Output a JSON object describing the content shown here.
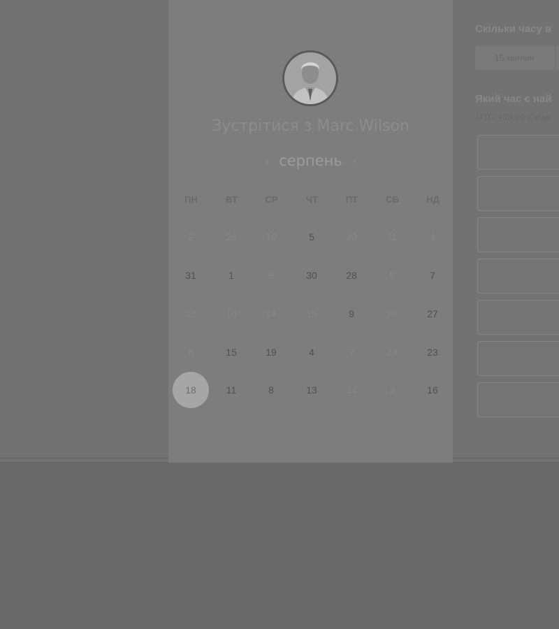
{
  "profile": {
    "meet_title": "Зустрітися з Marc Wilson"
  },
  "calendar": {
    "month": "серпень",
    "prev_icon": "chevron-left-icon",
    "next_icon": "chevron-right-icon",
    "weekdays": [
      "ПН",
      "ВТ",
      "СР",
      "ЧТ",
      "ПТ",
      "СБ",
      "НД"
    ],
    "rows": [
      [
        {
          "label": "2",
          "active": false
        },
        {
          "label": "29",
          "active": false
        },
        {
          "label": "19",
          "active": false
        },
        {
          "label": "5",
          "active": true
        },
        {
          "label": "20",
          "active": false
        },
        {
          "label": "11",
          "active": false
        },
        {
          "label": "4",
          "active": false
        }
      ],
      [
        {
          "label": "31",
          "active": true
        },
        {
          "label": "1",
          "active": true
        },
        {
          "label": "9",
          "active": false
        },
        {
          "label": "30",
          "active": true
        },
        {
          "label": "28",
          "active": true
        },
        {
          "label": "6",
          "active": false
        },
        {
          "label": "7",
          "active": true
        }
      ],
      [
        {
          "label": "12",
          "active": false
        },
        {
          "label": "10",
          "active": false
        },
        {
          "label": "24",
          "active": false
        },
        {
          "label": "15",
          "active": false
        },
        {
          "label": "9",
          "active": true
        },
        {
          "label": "26",
          "active": false
        },
        {
          "label": "27",
          "active": true
        }
      ],
      [
        {
          "label": "8",
          "active": false
        },
        {
          "label": "15",
          "active": true
        },
        {
          "label": "19",
          "active": true
        },
        {
          "label": "4",
          "active": true
        },
        {
          "label": "7",
          "active": false
        },
        {
          "label": "24",
          "active": false
        },
        {
          "label": "23",
          "active": true
        }
      ],
      [
        {
          "label": "18",
          "active": true,
          "selected": true
        },
        {
          "label": "11",
          "active": true
        },
        {
          "label": "8",
          "active": true
        },
        {
          "label": "13",
          "active": true
        },
        {
          "label": "14",
          "active": false
        },
        {
          "label": "3",
          "active": false
        },
        {
          "label": "16",
          "active": true
        }
      ]
    ]
  },
  "booking": {
    "duration_question": "Скільки часу в",
    "duration_option": "15 хвилин",
    "time_question": "Який час є най",
    "timezone": "UTC +03:00 Східн"
  }
}
